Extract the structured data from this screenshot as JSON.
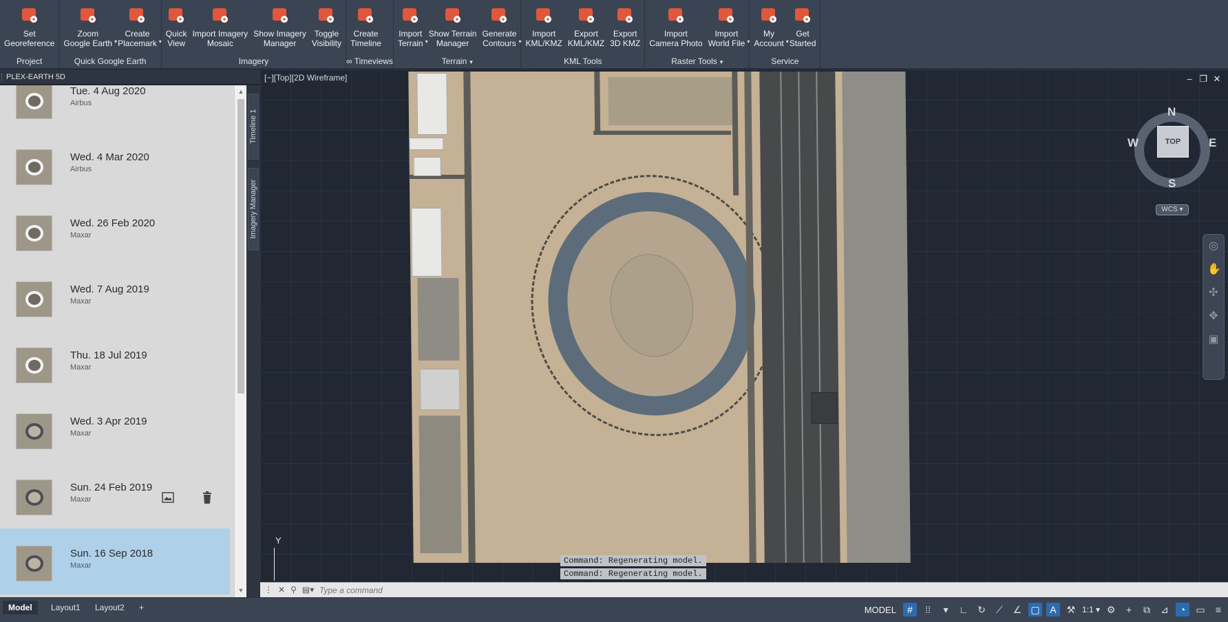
{
  "ribbon": {
    "groups": [
      {
        "label": "Project",
        "buttons": [
          {
            "label": "Set\nGeoreference",
            "icon": "georeference-icon"
          }
        ]
      },
      {
        "label": "Quick Google Earth",
        "buttons": [
          {
            "label": "Zoom\nGoogle Earth",
            "icon": "zoom-google-earth-icon",
            "dropdown": true
          },
          {
            "label": "Create\nPlacemark",
            "icon": "placemark-icon",
            "dropdown": true
          }
        ]
      },
      {
        "label": "Imagery",
        "buttons": [
          {
            "label": "Quick\nView",
            "icon": "quick-view-icon"
          },
          {
            "label": "Import Imagery\nMosaic",
            "icon": "import-mosaic-icon"
          },
          {
            "label": "Show Imagery\nManager",
            "icon": "imagery-manager-icon"
          },
          {
            "label": "Toggle\nVisibility",
            "icon": "toggle-visibility-icon"
          }
        ]
      },
      {
        "label": "∞ Timeviews",
        "buttons": [
          {
            "label": "Create\nTimeline",
            "icon": "timeline-icon"
          }
        ]
      },
      {
        "label": "Terrain",
        "caret": true,
        "buttons": [
          {
            "label": "Import\nTerrain",
            "icon": "import-terrain-icon",
            "dropdown": true
          },
          {
            "label": "Show Terrain\nManager",
            "icon": "terrain-manager-icon"
          },
          {
            "label": "Generate\nContours",
            "icon": "contours-icon",
            "dropdown": true
          }
        ]
      },
      {
        "label": "KML Tools",
        "buttons": [
          {
            "label": "Import\nKML/KMZ",
            "icon": "import-kml-icon"
          },
          {
            "label": "Export\nKML/KMZ",
            "icon": "export-kml-icon"
          },
          {
            "label": "Export\n3D KMZ",
            "icon": "export-3d-kmz-icon"
          }
        ]
      },
      {
        "label": "Raster Tools",
        "caret": true,
        "buttons": [
          {
            "label": "Import\nCamera Photo",
            "icon": "camera-photo-icon"
          },
          {
            "label": "Import\nWorld File",
            "icon": "world-file-icon",
            "dropdown": true
          }
        ]
      },
      {
        "label": "Service",
        "buttons": [
          {
            "label": "My\nAccount",
            "icon": "account-icon",
            "dropdown": true
          },
          {
            "label": "Get\nStarted",
            "icon": "get-started-icon"
          }
        ]
      }
    ],
    "accent_color": "#e0573b"
  },
  "palette": {
    "title": "PLEX-EARTH 5D",
    "tabs": [
      "Timeline 1",
      "Imagery Manager"
    ],
    "items": [
      {
        "date": "Tue. 4 Aug 2020",
        "source": "Airbus"
      },
      {
        "date": "Wed. 4 Mar 2020",
        "source": "Airbus"
      },
      {
        "date": "Wed. 26 Feb 2020",
        "source": "Maxar"
      },
      {
        "date": "Wed. 7 Aug 2019",
        "source": "Maxar"
      },
      {
        "date": "Thu. 18 Jul 2019",
        "source": "Maxar"
      },
      {
        "date": "Wed. 3 Apr 2019",
        "source": "Maxar"
      },
      {
        "date": "Sun. 24 Feb 2019",
        "source": "Maxar"
      },
      {
        "date": "Sun. 16 Sep 2018",
        "source": "Maxar"
      }
    ],
    "selected_index": 7,
    "hovered_index": 6
  },
  "viewport": {
    "label": "[−][Top][2D Wireframe]",
    "viewcube": {
      "top": "TOP",
      "n": "N",
      "s": "S",
      "e": "E",
      "w": "W",
      "wcs": "WCS ▾"
    },
    "ucs_y": "Y"
  },
  "command": {
    "history": [
      "Command: Regenerating model.",
      "Command: Regenerating model."
    ],
    "placeholder": "Type a command"
  },
  "statusbar": {
    "tabs": [
      "Model",
      "Layout1",
      "Layout2"
    ],
    "add_tab": "+",
    "model_label": "MODEL",
    "scale": "1:1 ▾"
  }
}
